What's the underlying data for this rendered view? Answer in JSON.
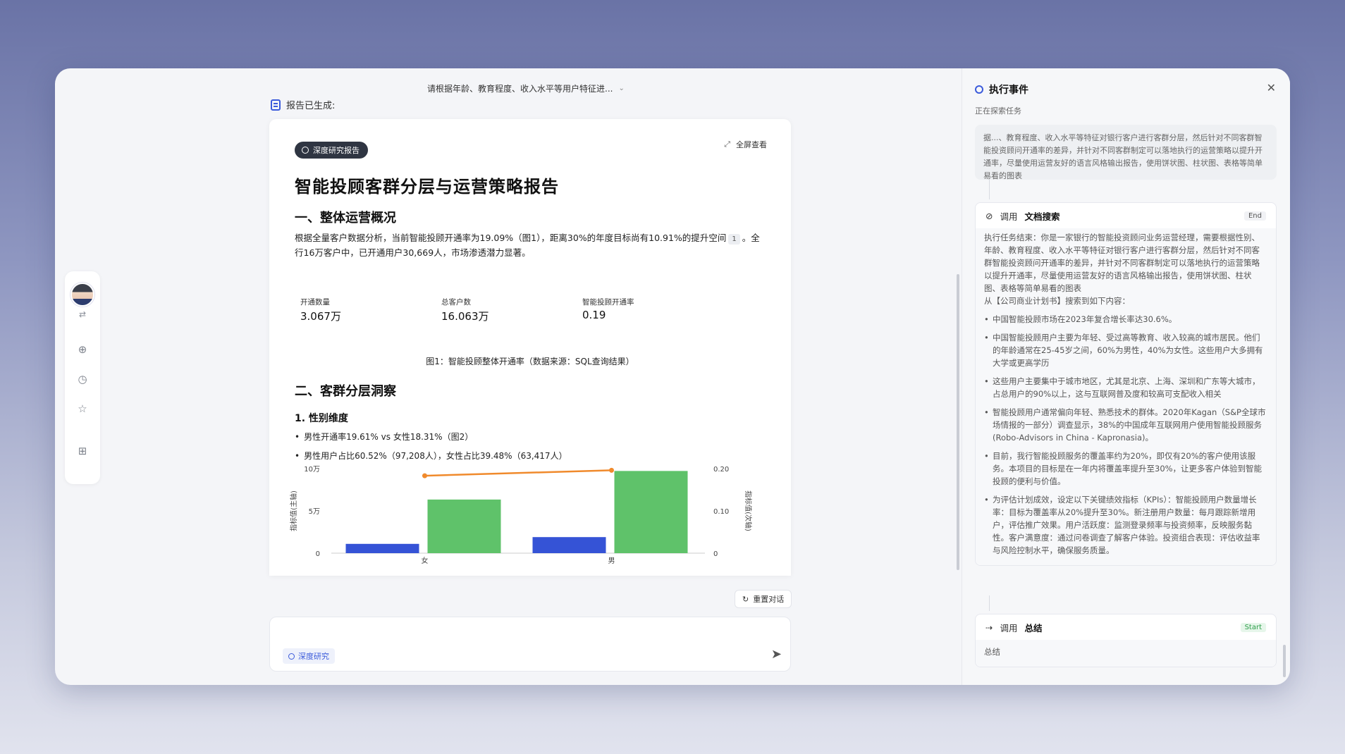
{
  "header": {
    "query": "请根据年龄、教育程度、收入水平等用户特征进...",
    "report_ready": "报告已生成:"
  },
  "report": {
    "badge": "深度研究报告",
    "fullscreen": "全屏查看",
    "title": "智能投顾客群分层与运营策略报告",
    "section1": "一、整体运营概况",
    "para1_a": "根据全量客户数据分析，当前智能投顾开通率为19.09%（图1），距离30%的年度目标尚有10.91%的提升空间",
    "para1_ref": "1",
    "para1_b": "。全行16万客户中，已开通用户30,669人，市场渗透潜力显著。",
    "metrics": [
      {
        "label": "开通数量",
        "value": "3.067万"
      },
      {
        "label": "总客户数",
        "value": "16.063万"
      },
      {
        "label": "智能投顾开通率",
        "value": "0.19"
      }
    ],
    "fig1_caption": "图1：智能投顾整体开通率（数据来源：SQL查询结果）",
    "section2": "二、客群分层洞察",
    "sub1": "1. 性别维度",
    "bullet1": "男性开通率19.61% vs 女性18.31%（图2）",
    "bullet2": "男性用户占比60.52%（97,208人），女性占比39.48%（63,417人）"
  },
  "chart_data": {
    "type": "bar",
    "categories": [
      "女",
      "男"
    ],
    "series": [
      {
        "name": "",
        "values": [
          11000,
          19000
        ],
        "color": "#3553d6"
      },
      {
        "name": "",
        "values": [
          63417,
          97208
        ],
        "color": "#5fc26a"
      }
    ],
    "line": {
      "values": [
        0.1831,
        0.1961
      ],
      "color": "#f08a2c"
    },
    "y_left": {
      "label": "指标值(主轴)",
      "ticks": [
        "10万",
        "5万",
        "0"
      ],
      "max": 100000
    },
    "y_right": {
      "label": "指标值(次轴)",
      "ticks": [
        "0.20",
        "0.10",
        "0"
      ],
      "max": 0.2
    }
  },
  "controls": {
    "reset": "重置对话",
    "input_placeholder": "",
    "chip": "深度研究"
  },
  "panel": {
    "title": "执行事件",
    "exploring": "正在探索任务",
    "top_text": "据...、教育程度、收入水平等特征对银行客户进行客群分层，然后针对不同客群智能投资顾问开通率的差异，并针对不同客群制定可以落地执行的运营策略以提升开通率，尽量使用运营友好的语言风格输出报告，使用饼状图、柱状图、表格等简单易看的图表",
    "call1": {
      "prefix": "调用",
      "name": "文档搜索",
      "tag": "End",
      "intro": "执行任务结束：你是一家银行的智能投资顾问业务运营经理，需要根据性别、年龄、教育程度、收入水平等特征对银行客户进行客群分层，然后针对不同客群智能投资顾问开通率的差异，并针对不同客群制定可以落地执行的运营策略以提升开通率，尽量使用运营友好的语言风格输出报告，使用饼状图、柱状图、表格等简单易看的图表",
      "from": "从【公司商业计划书】搜索到如下内容：",
      "items": [
        "中国智能投顾市场在2023年复合增长率达30.6%。",
        "中国智能投顾用户主要为年轻、受过高等教育、收入较高的城市居民。他们的年龄通常在25-45岁之间，60%为男性，40%为女性。这些用户大多拥有大学或更高学历",
        "这些用户主要集中于城市地区，尤其是北京、上海、深圳和广东等大城市，占总用户的90%以上，这与互联网普及度和较高可支配收入相关",
        "智能投顾用户通常偏向年轻、熟悉技术的群体。2020年Kagan（S&P全球市场情报的一部分）调查显示，38%的中国成年互联网用户使用智能投顾服务 (Robo-Advisors in China - Kapronasia)。",
        "目前，我行智能投顾服务的覆盖率约为20%，即仅有20%的客户使用该服务。本项目的目标是在一年内将覆盖率提升至30%，让更多客户体验到智能投顾的便利与价值。",
        "为评估计划成效，设定以下关键绩效指标（KPIs）：智能投顾用户数量增长率：目标为覆盖率从20%提升至30%。新注册用户数量：每月跟踪新增用户，评估推广效果。用户活跃度：监测登录频率与投资频率，反映服务黏性。客户满意度：通过问卷调查了解客户体验。投资组合表现：评估收益率与风险控制水平，确保服务质量。"
      ]
    },
    "call2": {
      "prefix": "调用",
      "name": "总结",
      "tag": "Start",
      "body": "总结"
    }
  }
}
